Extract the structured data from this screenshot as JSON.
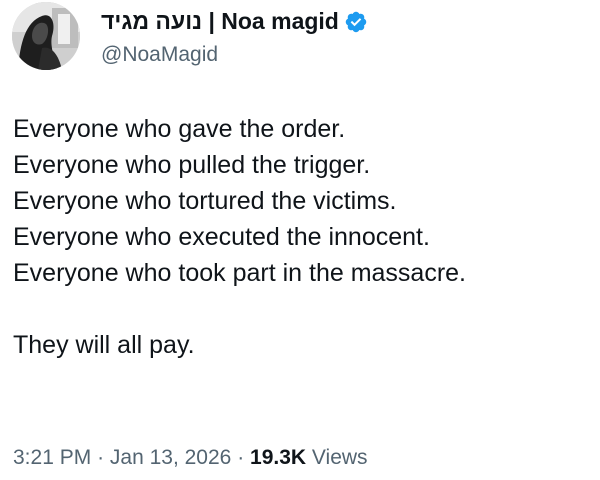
{
  "author": {
    "display_name": "נועה מגיד | Noa magid",
    "handle": "@NoaMagid"
  },
  "tweet": {
    "lines": [
      "Everyone who gave the order.",
      "Everyone who pulled the trigger.",
      "Everyone who tortured the victims.",
      "Everyone who executed the innocent.",
      "Everyone who took part in the massacre."
    ],
    "closing": "They will all pay."
  },
  "meta": {
    "time": "3:21 PM",
    "separator": "·",
    "date": "Jan 13, 2026",
    "views_count": "19.3K",
    "views_label": "Views"
  },
  "colors": {
    "text": "#0f1419",
    "secondary": "#536471",
    "verified": "#1d9bf0",
    "background": "#ffffff"
  },
  "icons": {
    "verified": "verified-badge-icon"
  }
}
